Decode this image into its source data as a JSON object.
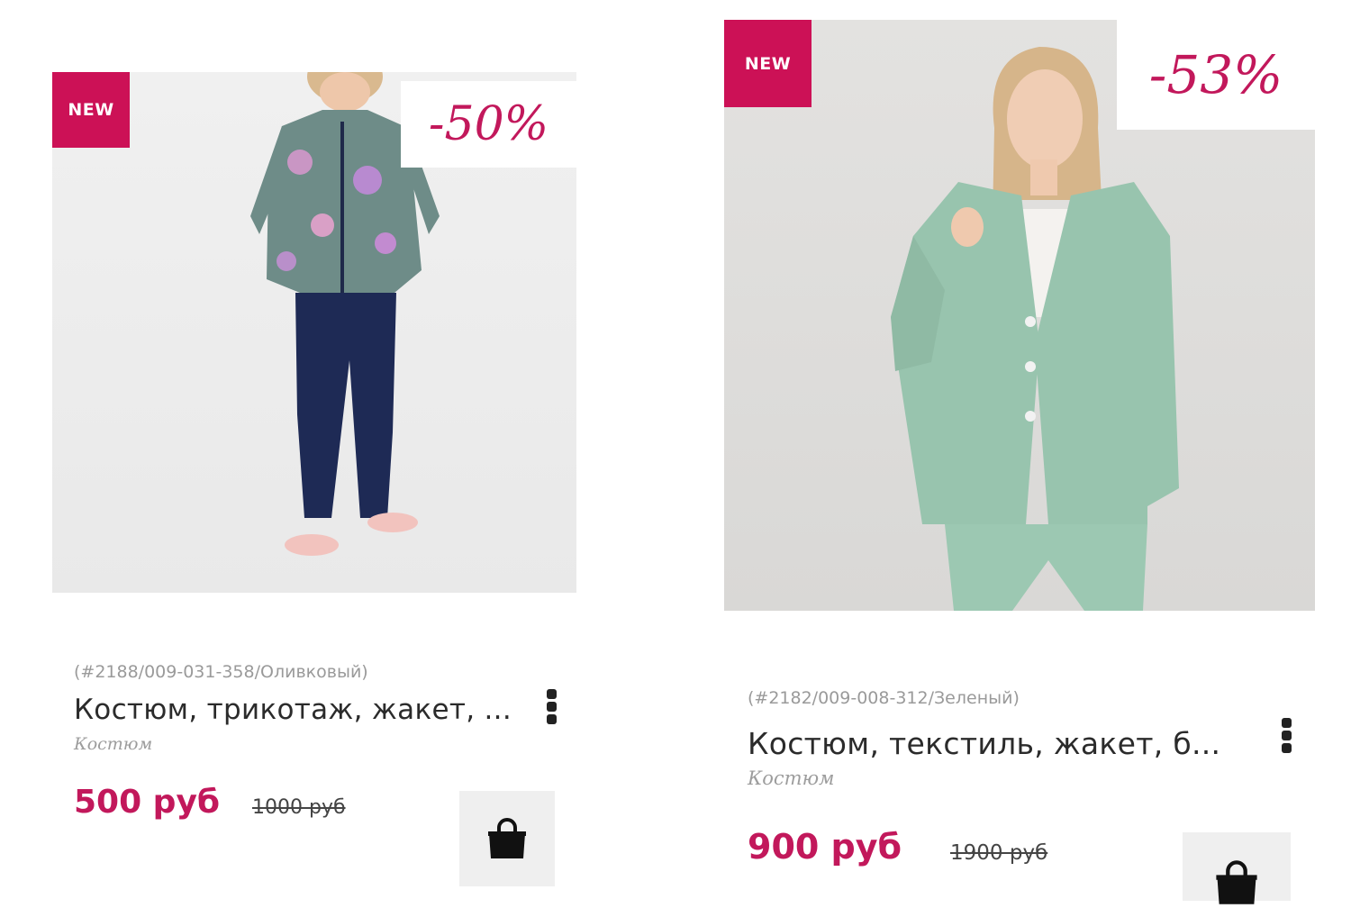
{
  "products": [
    {
      "badge": "NEW",
      "discount": "-50%",
      "sku": "(#2188/009-031-358/Оливковый)",
      "title": "Костюм, трикотаж, жакет, ...",
      "category": "Костюм",
      "price": "500 руб",
      "old_price": "1000 руб",
      "image_icon": "product-photo-floral-suit"
    },
    {
      "badge": "NEW",
      "discount": "-53%",
      "sku": "(#2182/009-008-312/Зеленый)",
      "title": "Костюм, текстиль, жакет, б...",
      "category": "Костюм",
      "price": "900 руб",
      "old_price": "1900 руб",
      "image_icon": "product-photo-green-suit"
    }
  ],
  "colors": {
    "accent": "#cc1156",
    "price": "#c2185b"
  },
  "icons": {
    "more": "more-vertical-icon",
    "cart": "shopping-bag-icon"
  }
}
